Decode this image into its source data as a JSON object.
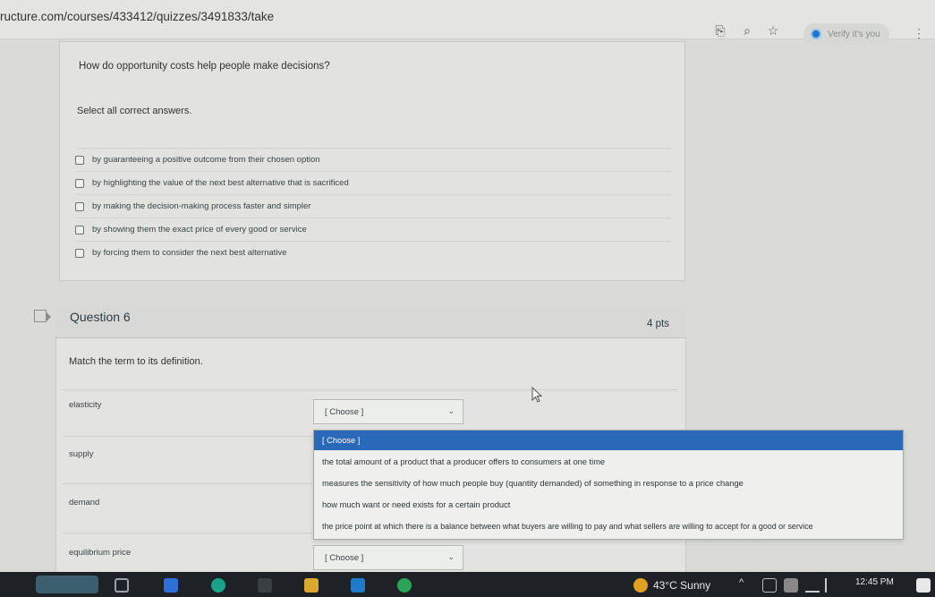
{
  "browser": {
    "url": "ructure.com/courses/433412/quizzes/3491833/take",
    "verify_label": "Verify it's you"
  },
  "question5": {
    "text": "How do opportunity costs help people make decisions?",
    "instruction": "Select all correct answers.",
    "answers": [
      "by guaranteeing a positive outcome from their chosen option",
      "by highlighting the value of the next best alternative that is sacrificed",
      "by making the decision-making process faster and simpler",
      "by showing them the exact price of every good or service",
      "by forcing them to consider the next best alternative"
    ]
  },
  "question6": {
    "title": "Question 6",
    "points": "4 pts",
    "prompt": "Match the term to its definition.",
    "terms": [
      "elasticity",
      "supply",
      "demand",
      "equilibrium price"
    ],
    "select_placeholder": "[ Choose ]",
    "dropdown_options": [
      "[ Choose ]",
      "the total amount of a product that a producer offers to consumers at one time",
      "measures the sensitivity of how much people buy (quantity demanded) of something in response to a price change",
      "how much want or need exists for a certain product",
      "the price point at which there is a balance between what buyers are willing to pay and what sellers are willing to accept for a good or service"
    ]
  },
  "taskbar": {
    "weather": "43°C  Sunny",
    "time": "12:45 PM"
  }
}
